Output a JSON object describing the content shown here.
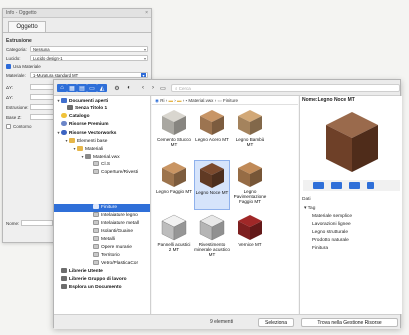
{
  "info": {
    "title": "Info - Oggetto",
    "tab": "Oggetto",
    "section": "Estrusione",
    "category_label": "Categoria:",
    "category_value": "Nessuna",
    "lucido_label": "Lucido:",
    "lucido_value": "Lucido design-1",
    "usa_materiale_label": "Usa Materiale",
    "materiale_label": "Materiale:",
    "materiale_value": "1-Muratura standard MT",
    "dx_label": "ΔY:",
    "dx2_label": "ΔY:",
    "estrusione_label": "Estrusione:",
    "base_label": "Base Z:",
    "contorno_label": "Contorno",
    "nome_label": "Nome:"
  },
  "toolbar": {
    "search_placeholder": "Cerca"
  },
  "tree": {
    "items": [
      {
        "label": "Documenti aperti",
        "bold": true
      },
      {
        "label": "Senza Titolo 1",
        "bold": true
      },
      {
        "label": "Catalogo",
        "bold": true
      },
      {
        "label": "Risorse Premium",
        "bold": true
      },
      {
        "label": "Risorse Vectorworks",
        "bold": true
      },
      {
        "label": "Elementi base",
        "bold": false
      },
      {
        "label": "Materiali",
        "bold": false
      },
      {
        "label": "Material.vwx",
        "bold": false
      },
      {
        "label": "Cl.S",
        "bold": false
      },
      {
        "label": "Coperture/Rivesti",
        "bold": false
      },
      {
        "label": "Finiture",
        "bold": false
      },
      {
        "label": "Intelaiature legno",
        "bold": false
      },
      {
        "label": "Intelaiature metall",
        "bold": false
      },
      {
        "label": "Isolanti/Guaine",
        "bold": false
      },
      {
        "label": "Metalli",
        "bold": false
      },
      {
        "label": "Opere murarie",
        "bold": false
      },
      {
        "label": "Territorio",
        "bold": false
      },
      {
        "label": "Vetro/PlasticaCor",
        "bold": false
      },
      {
        "label": "Librerie Utente",
        "bold": true
      },
      {
        "label": "Librerie Gruppo di lavoro",
        "bold": true
      },
      {
        "label": "Esplora un Documento",
        "bold": true
      }
    ]
  },
  "breadcrumb": {
    "root": "Ri",
    "file": "Material.vwx",
    "folder": "Finiture"
  },
  "grid": {
    "items": [
      {
        "label": "Cemento Stucco MT",
        "color": "#d9d6cf"
      },
      {
        "label": "Legno Acero MT",
        "color": "#c89566"
      },
      {
        "label": "Legno Bambù MT",
        "color": "#d2a877"
      },
      {
        "label": "Legno Faggio MT",
        "color": "#c99563"
      },
      {
        "label": "Legno Noce MT",
        "color": "#7b4a2e"
      },
      {
        "label": "Legno Pavimentazione Faggio MT",
        "color": "#c08a58"
      },
      {
        "label": "Pannelli acustici 2 MT",
        "color": "#f2f2f2"
      },
      {
        "label": "Rivestimento minerale acustico MT",
        "color": "#e8e8e8"
      },
      {
        "label": "Vernice MT",
        "color": "#a02828"
      }
    ]
  },
  "details": {
    "name_label": "Nome:",
    "name_value": "Legno Noce MT",
    "dati_label": "Dati",
    "tag_label": "Tag",
    "tags": [
      "Materiale semplice",
      "Lavorazioni lignee",
      "Legno strutturale",
      "Prodotto naturale",
      "Finitura"
    ]
  },
  "footer": {
    "count": "9 elementi",
    "select_button": "Seleziona",
    "find_button": "Trova nella Gestione Risorse"
  }
}
